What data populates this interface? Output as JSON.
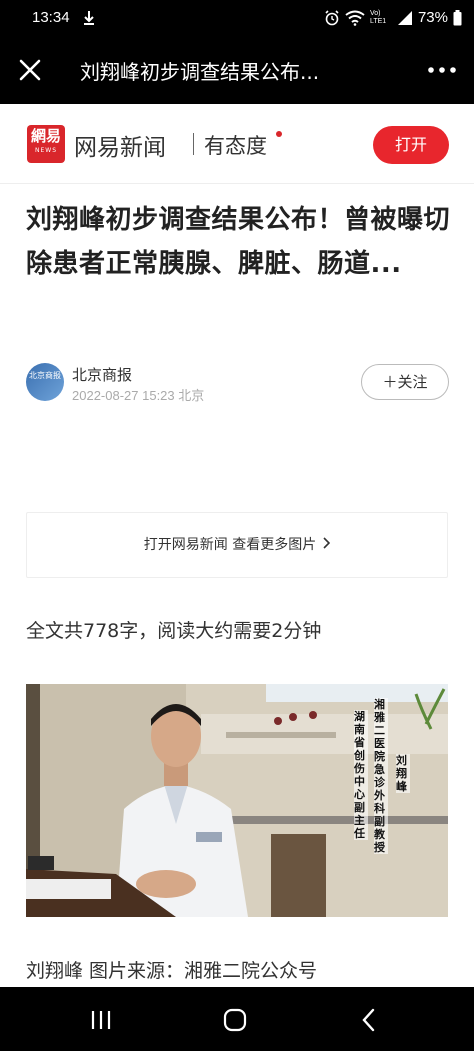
{
  "status_bar": {
    "time": "13:34",
    "network": "Vo) LTE1",
    "battery": "73%"
  },
  "app_bar": {
    "title": "刘翔峰初步调查结果公布..."
  },
  "brand": {
    "logo_text": "網易",
    "logo_sub": "NEWS",
    "name": "网易新闻",
    "slogan": "有态度",
    "open_label": "打开",
    "accent": "#e8262d"
  },
  "article": {
    "headline": "刘翔峰初步调查结果公布！曾被曝切除患者正常胰腺、脾脏、肠道...",
    "author": "北京商报",
    "avatar_text": "北京商报",
    "meta": "2022-08-27 15:23 北京",
    "follow_label": "＋关注",
    "more_images_label": "打开网易新闻 查看更多图片",
    "word_count": "全文共778字，阅读大约需要2分钟",
    "photo_text_col1": "湘雅二医院急诊外科副教授",
    "photo_text_col2": "湖南省创伤中心副主任",
    "photo_name": "刘翔峰",
    "caption": "刘翔峰 图片来源：湘雅二院公众号"
  }
}
